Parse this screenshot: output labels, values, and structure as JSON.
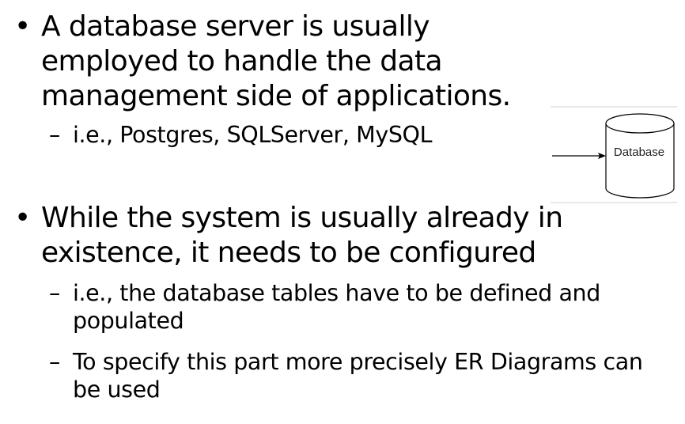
{
  "bullets": [
    {
      "symbol": "•",
      "text": "A database server is usually employed to handle the data management side of applications.",
      "subitems": [
        {
          "dash": "–",
          "text": "i.e., Postgres, SQLServer, MySQL"
        }
      ]
    },
    {
      "symbol": "•",
      "text": "While the system is usually already in existence, it needs to be configured",
      "subitems": [
        {
          "dash": "–",
          "text": "i.e., the database tables have to be defined and populated"
        },
        {
          "dash": "–",
          "text": "To specify this part more precisely ER Diagrams can be used"
        }
      ]
    }
  ],
  "diagram": {
    "label": "Database",
    "shape": "cylinder",
    "stroke_color": "#000000",
    "border_color": "#d0d0d0"
  }
}
